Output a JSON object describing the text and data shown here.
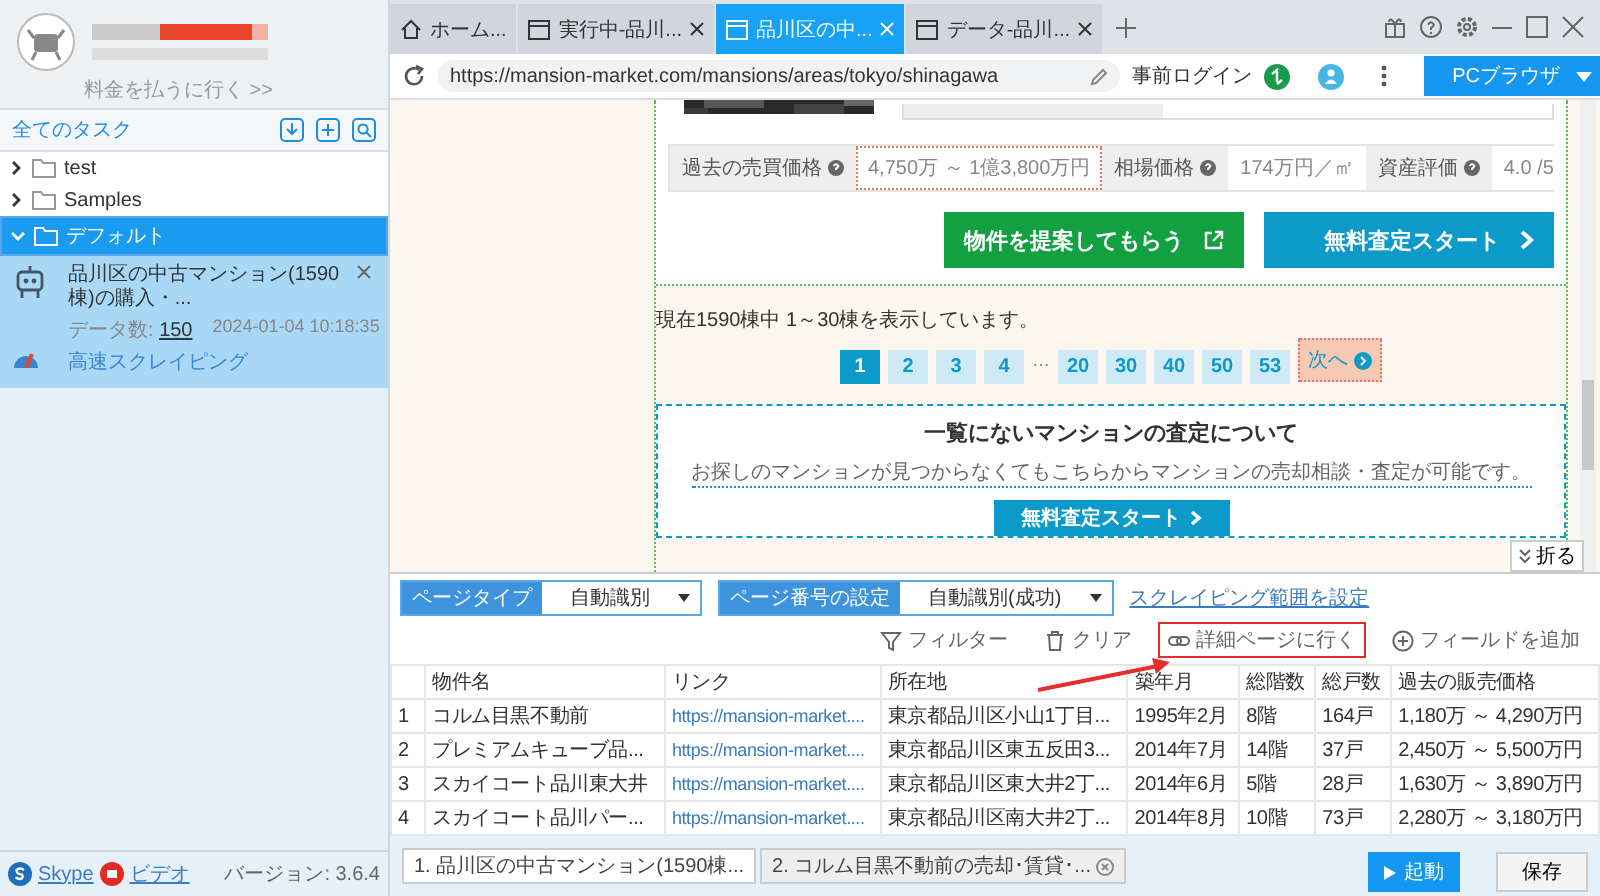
{
  "sidebar": {
    "pay_link": "料金を払うに行く >>",
    "header": "全てのタスク",
    "tree": [
      {
        "label": "test",
        "expanded": false,
        "selected": false
      },
      {
        "label": "Samples",
        "expanded": false,
        "selected": false
      },
      {
        "label": "デフォルト",
        "expanded": true,
        "selected": true,
        "children": [
          {
            "title": "品川区の中古マンション(1590棟)の購入・...",
            "count_label": "データ数:",
            "count": "150",
            "date": "2024-01-04 10:18:35",
            "mode": "高速スクレイピング"
          }
        ]
      }
    ],
    "footer_links": [
      "Skype",
      "ビデオ"
    ],
    "version": "バージョン: 3.6.4"
  },
  "browser": {
    "tabs": [
      {
        "label": "ホーム...",
        "kind": "home",
        "selected": false
      },
      {
        "label": "実行中-品川...",
        "kind": "page",
        "selected": false
      },
      {
        "label": "品川区の中...",
        "kind": "page",
        "selected": true
      },
      {
        "label": "データ-品川...",
        "kind": "page",
        "selected": false
      }
    ],
    "url": "https://mansion-market.com/mansions/areas/tokyo/shinagawa",
    "prelogin": "事前ログイン",
    "mode_button": "PCブラウザ"
  },
  "page": {
    "price_rows": [
      {
        "label": "過去の売買価格",
        "value": "4,750万 ～ 1億3,800万円",
        "highlighted": true
      },
      {
        "label": "相場価格",
        "value": "174万円／㎡",
        "highlighted": false
      },
      {
        "label": "資産評価",
        "value": "4.0 /5",
        "highlighted": false
      }
    ],
    "buttons": [
      {
        "label": "物件を提案してもらう",
        "kind": "external"
      },
      {
        "label": "無料査定スタート",
        "kind": "next"
      }
    ],
    "count_text": "現在1590棟中 1～30棟を表示しています。",
    "pages": [
      {
        "label": "1",
        "selected": true
      },
      {
        "label": "2",
        "selected": false
      },
      {
        "label": "3",
        "selected": false
      },
      {
        "label": "4",
        "selected": false
      },
      {
        "label": "…",
        "kind": "ellipsis"
      },
      {
        "label": "20",
        "selected": false
      },
      {
        "label": "30",
        "selected": false
      },
      {
        "label": "40",
        "selected": false
      },
      {
        "label": "50",
        "selected": false
      },
      {
        "label": "53",
        "selected": false
      }
    ],
    "next": {
      "label": "次へ",
      "highlighted": true
    },
    "box": {
      "title": "一覧にないマンションの査定について",
      "text": "お探しのマンションが見つからなくてもこちらからマンションの売却相談・査定が可能です。",
      "button": "無料査定スタート"
    },
    "collapse": "折る"
  },
  "panel": {
    "selects": [
      {
        "label": "ページタイプ",
        "value": "自動識別"
      },
      {
        "label": "ページ番号の設定",
        "value": "自動識別(成功)"
      }
    ],
    "range_link": "スクレイピング範囲を設定",
    "actions": [
      {
        "label": "フィルター",
        "kind": "filter",
        "highlighted": false
      },
      {
        "label": "クリア",
        "kind": "trash",
        "highlighted": false
      },
      {
        "label": "詳細ページに行く",
        "kind": "link",
        "highlighted": true
      },
      {
        "label": "フィールドを追加",
        "kind": "add",
        "highlighted": false
      }
    ],
    "columns": [
      "物件名",
      "リンク",
      "所在地",
      "築年月",
      "総階数",
      "総戸数",
      "過去の販売価格"
    ],
    "rows": [
      {
        "index": "1",
        "cells": [
          "コルム目黒不動前",
          "https://mansion-market....",
          "東京都品川区小山1丁目...",
          "1995年2月",
          "8階",
          "164戸",
          "1,180万 ～ 4,290万円"
        ]
      },
      {
        "index": "2",
        "cells": [
          "プレミアムキューブ品...",
          "https://mansion-market....",
          "東京都品川区東五反田3...",
          "2014年7月",
          "14階",
          "37戸",
          "2,450万 ～ 5,500万円"
        ]
      },
      {
        "index": "3",
        "cells": [
          "スカイコート品川東大井",
          "https://mansion-market....",
          "東京都品川区東大井2丁...",
          "2014年6月",
          "5階",
          "28戸",
          "1,630万 ～ 3,890万円"
        ]
      },
      {
        "index": "4",
        "cells": [
          "スカイコート品川パー...",
          "https://mansion-market....",
          "東京都品川区南大井2丁...",
          "2014年8月",
          "10階",
          "73戸",
          "2,280万 ～ 3,180万円"
        ]
      }
    ],
    "result_tabs": [
      {
        "label": "1. 品川区の中古マンション(1590棟...",
        "selected": true
      },
      {
        "label": "2. コルム目黒不動前の売却･賃貸･...",
        "selected": false
      }
    ],
    "run_button": "起動",
    "save_button": "保存"
  }
}
